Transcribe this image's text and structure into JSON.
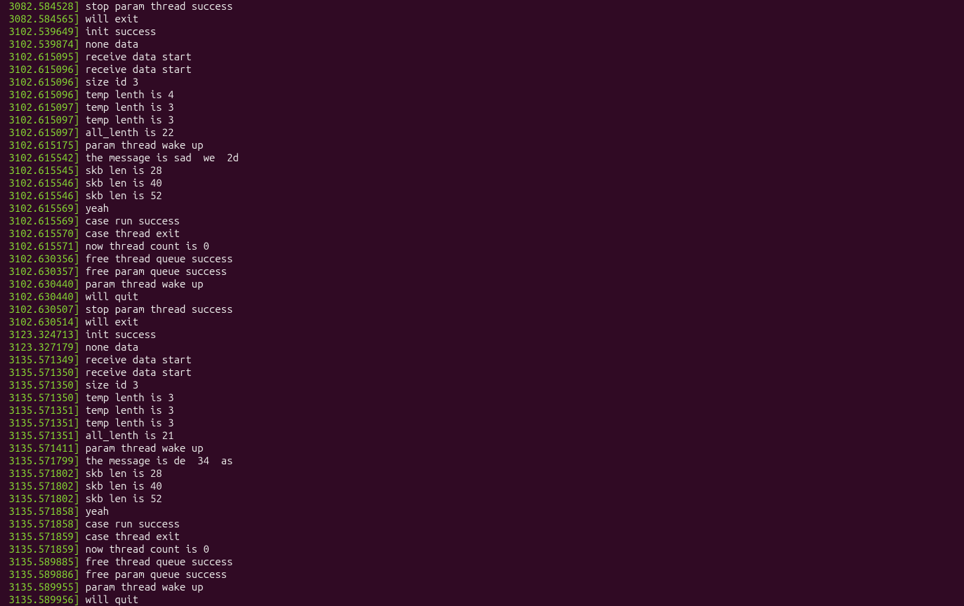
{
  "log_lines": [
    {
      "timestamp": " 3082.584528]",
      "message": " stop param thread success"
    },
    {
      "timestamp": " 3082.584565]",
      "message": " will exit"
    },
    {
      "timestamp": " 3102.539649]",
      "message": " init success"
    },
    {
      "timestamp": " 3102.539874]",
      "message": " none data"
    },
    {
      "timestamp": " 3102.615095]",
      "message": " receive data start"
    },
    {
      "timestamp": " 3102.615096]",
      "message": " receive data start"
    },
    {
      "timestamp": " 3102.615096]",
      "message": " size id 3"
    },
    {
      "timestamp": " 3102.615096]",
      "message": " temp lenth is 4"
    },
    {
      "timestamp": " 3102.615097]",
      "message": " temp lenth is 3"
    },
    {
      "timestamp": " 3102.615097]",
      "message": " temp lenth is 3"
    },
    {
      "timestamp": " 3102.615097]",
      "message": " all_lenth is 22 "
    },
    {
      "timestamp": " 3102.615175]",
      "message": " param thread wake up"
    },
    {
      "timestamp": " 3102.615542]",
      "message": " the message is sad  we  2d"
    },
    {
      "timestamp": " 3102.615545]",
      "message": " skb len is 28"
    },
    {
      "timestamp": " 3102.615546]",
      "message": " skb len is 40"
    },
    {
      "timestamp": " 3102.615546]",
      "message": " skb len is 52"
    },
    {
      "timestamp": " 3102.615569]",
      "message": " yeah"
    },
    {
      "timestamp": " 3102.615569]",
      "message": " case run success"
    },
    {
      "timestamp": " 3102.615570]",
      "message": " case thread exit"
    },
    {
      "timestamp": " 3102.615571]",
      "message": " now thread count is 0"
    },
    {
      "timestamp": " 3102.630356]",
      "message": " free thread queue success"
    },
    {
      "timestamp": " 3102.630357]",
      "message": " free param queue success"
    },
    {
      "timestamp": " 3102.630440]",
      "message": " param thread wake up"
    },
    {
      "timestamp": " 3102.630440]",
      "message": " will quit"
    },
    {
      "timestamp": " 3102.630507]",
      "message": " stop param thread success"
    },
    {
      "timestamp": " 3102.630514]",
      "message": " will exit"
    },
    {
      "timestamp": " 3123.324713]",
      "message": " init success"
    },
    {
      "timestamp": " 3123.327179]",
      "message": " none data"
    },
    {
      "timestamp": " 3135.571349]",
      "message": " receive data start"
    },
    {
      "timestamp": " 3135.571350]",
      "message": " receive data start"
    },
    {
      "timestamp": " 3135.571350]",
      "message": " size id 3"
    },
    {
      "timestamp": " 3135.571350]",
      "message": " temp lenth is 3"
    },
    {
      "timestamp": " 3135.571351]",
      "message": " temp lenth is 3"
    },
    {
      "timestamp": " 3135.571351]",
      "message": " temp lenth is 3"
    },
    {
      "timestamp": " 3135.571351]",
      "message": " all_lenth is 21 "
    },
    {
      "timestamp": " 3135.571411]",
      "message": " param thread wake up"
    },
    {
      "timestamp": " 3135.571799]",
      "message": " the message is de  34  as"
    },
    {
      "timestamp": " 3135.571802]",
      "message": " skb len is 28"
    },
    {
      "timestamp": " 3135.571802]",
      "message": " skb len is 40"
    },
    {
      "timestamp": " 3135.571802]",
      "message": " skb len is 52"
    },
    {
      "timestamp": " 3135.571858]",
      "message": " yeah"
    },
    {
      "timestamp": " 3135.571858]",
      "message": " case run success"
    },
    {
      "timestamp": " 3135.571859]",
      "message": " case thread exit"
    },
    {
      "timestamp": " 3135.571859]",
      "message": " now thread count is 0"
    },
    {
      "timestamp": " 3135.589885]",
      "message": " free thread queue success"
    },
    {
      "timestamp": " 3135.589886]",
      "message": " free param queue success"
    },
    {
      "timestamp": " 3135.589955]",
      "message": " param thread wake up"
    },
    {
      "timestamp": " 3135.589956]",
      "message": " will quit"
    }
  ]
}
